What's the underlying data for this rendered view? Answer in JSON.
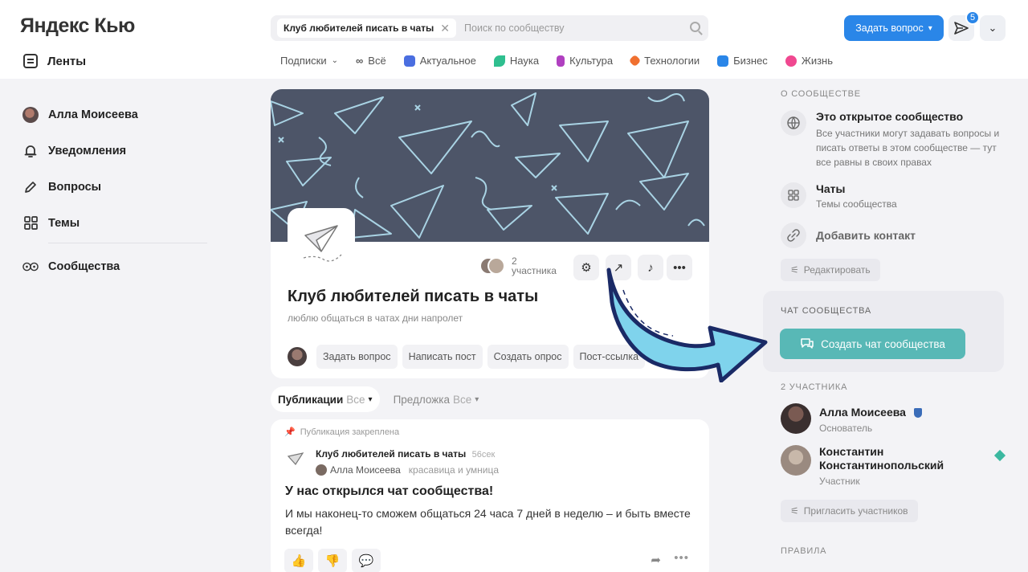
{
  "header": {
    "logo": "Яндекс Кью",
    "feeds_label": "Ленты",
    "search": {
      "chip": "Клуб любителей писать в чаты",
      "placeholder": "Поиск по сообществу"
    },
    "ask_button": "Задать вопрос",
    "notifications_count": "5"
  },
  "categories": [
    {
      "label": "Подписки",
      "color": "",
      "icon": "chevron-down"
    },
    {
      "label": "Всё",
      "color": "#555555",
      "icon": "infinity"
    },
    {
      "label": "Актуальное",
      "color": "#4a6ee0"
    },
    {
      "label": "Наука",
      "color": "#2fbf8f"
    },
    {
      "label": "Культура",
      "color": "#b040c0"
    },
    {
      "label": "Технологии",
      "color": "#f07030"
    },
    {
      "label": "Бизнес",
      "color": "#2a86e8"
    },
    {
      "label": "Жизнь",
      "color": "#f04890"
    }
  ],
  "nav": {
    "items": [
      {
        "label": "Алла Моисеева",
        "icon": "avatar"
      },
      {
        "label": "Уведомления",
        "icon": "bell-icon"
      },
      {
        "label": "Вопросы",
        "icon": "pencil-icon"
      },
      {
        "label": "Темы",
        "icon": "grid-icon"
      },
      {
        "label": "Сообщества",
        "icon": "community-icon"
      }
    ]
  },
  "club": {
    "members_count": "2",
    "members_word": "участника",
    "title": "Клуб любителей писать в чаты",
    "subtitle": "люблю общаться в чатах дни напролет",
    "actions": [
      "Задать вопрос",
      "Написать пост",
      "Создать опрос",
      "Пост-ссылка"
    ]
  },
  "tabs": {
    "publications": "Публикации",
    "publications_filter": "Все",
    "suggestions": "Предложка",
    "suggestions_filter": "Все"
  },
  "post": {
    "pinned": "Публикация закреплена",
    "club": "Клуб любителей писать в чаты",
    "time": "56сек",
    "author": "Алла Моисеева",
    "author_tag": "красавица и умница",
    "title": "У нас открылся чат сообщества!",
    "body": "И мы наконец-то сможем общаться 24 часа 7 дней в неделю – и быть вместе всегда!"
  },
  "about": {
    "section_title": "О сообществе",
    "open_title": "Это открытое сообщество",
    "open_desc": "Все участники могут задавать вопросы и писать ответы в этом сообществе — тут все равны в своих правах",
    "chats_title": "Чаты",
    "chats_desc": "Темы сообщества",
    "add_contact": "Добавить контакт",
    "edit_button": "Редактировать"
  },
  "chat": {
    "section_title": "Чат сообщества",
    "create_button": "Создать чат сообщества",
    "accent": "#58b8b6"
  },
  "members": {
    "section_title": "2 участника",
    "list": [
      {
        "name": "Алла Моисеева",
        "role": "Основатель"
      },
      {
        "name": "Константин Константинопольский",
        "role": "Участник"
      }
    ],
    "invite_button": "Пригласить участников"
  },
  "rules": {
    "section_title": "Правила"
  }
}
